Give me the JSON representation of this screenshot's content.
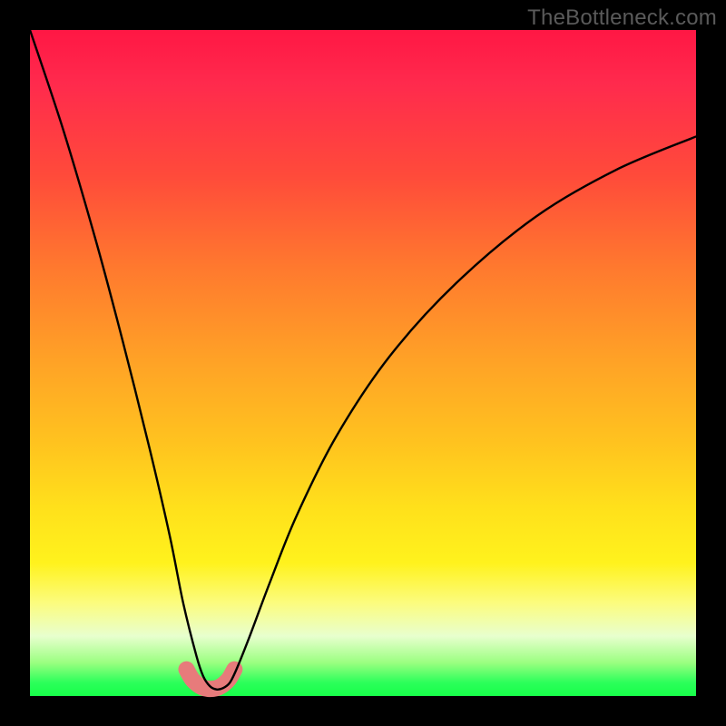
{
  "watermark": "TheBottleneck.com",
  "chart_data": {
    "type": "line",
    "title": "",
    "xlabel": "",
    "ylabel": "",
    "xlim": [
      0,
      100
    ],
    "ylim": [
      0,
      100
    ],
    "grid": false,
    "legend": false,
    "notes": "V-shaped bottleneck curve on unlabeled axes; value = 0 at the notch near x≈27, rising steeply to the left edge and more gently toward the right edge. y read as fraction of plot height from bottom.",
    "series": [
      {
        "name": "main-curve",
        "stroke": "#000000",
        "x": [
          0,
          5,
          10,
          14,
          18,
          21,
          23,
          25,
          26,
          27,
          28,
          29,
          30,
          31,
          33,
          36,
          40,
          46,
          54,
          64,
          76,
          88,
          100
        ],
        "values": [
          100,
          85,
          68,
          53,
          37,
          24,
          14,
          6,
          3,
          1.5,
          1,
          1.2,
          2,
          4,
          9,
          17,
          27,
          39,
          51,
          62,
          72,
          79,
          84
        ]
      },
      {
        "name": "bottom-highlight",
        "stroke": "#e77b7b",
        "stroke_width": 12,
        "x": [
          23.5,
          24.3,
          25.1,
          25.9,
          26.7,
          27.5,
          28.3,
          29.1,
          29.9,
          30.7
        ],
        "values": [
          4.0,
          2.6,
          1.8,
          1.3,
          1.1,
          1.1,
          1.3,
          1.8,
          2.6,
          4.0
        ]
      }
    ]
  }
}
